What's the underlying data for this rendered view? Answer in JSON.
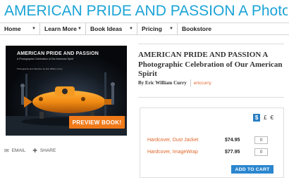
{
  "header": {
    "title": "AMERICAN PRIDE AND PASSION A Photogra..."
  },
  "nav": {
    "items": [
      {
        "label": "Home"
      },
      {
        "label": "Learn More"
      },
      {
        "label": "Book Ideas"
      },
      {
        "label": "Pricing"
      },
      {
        "label": "Bookstore"
      }
    ]
  },
  "cover": {
    "title": "AMERICAN PRIDE AND PASSION",
    "subtitle": "A Photographic Celebration of Our American Spirit",
    "author": "Photographs and Narrative by Eric William Curry",
    "preview_label": "PREVIEW BOOK!"
  },
  "share": {
    "email_label": "EMAIL",
    "share_label": "SHARE"
  },
  "book": {
    "title": "AMERICAN PRIDE AND PASSION A Photographic Celebration of Our American Spirit",
    "by_label": "By Eric William Curry",
    "author_handle": "ericcurry"
  },
  "purchase": {
    "currencies": [
      "$",
      "£",
      "€"
    ],
    "active_currency": "$",
    "options": [
      {
        "format": "Hardcover, Dust Jacket",
        "price": "$74.95",
        "qty": "0"
      },
      {
        "format": "Hardcover, ImageWrap",
        "price": "$77.95",
        "qty": "0"
      }
    ],
    "add_to_cart_label": "ADD TO CART"
  },
  "colors": {
    "title_blue": "#1aa3d6",
    "accent_orange": "#f07a1a",
    "link_orange": "#e0652a",
    "button_blue": "#2a86cf"
  }
}
